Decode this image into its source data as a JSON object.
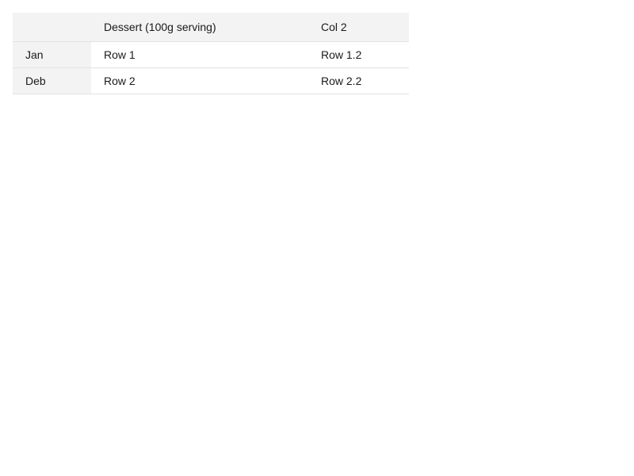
{
  "table": {
    "columns": [
      "",
      "Dessert (100g serving)",
      "Col 2"
    ],
    "rows": [
      {
        "label": "Jan",
        "cells": [
          "Row 1",
          "Row 1.2"
        ]
      },
      {
        "label": "Deb",
        "cells": [
          "Row 2",
          "Row 2.2"
        ]
      }
    ]
  }
}
